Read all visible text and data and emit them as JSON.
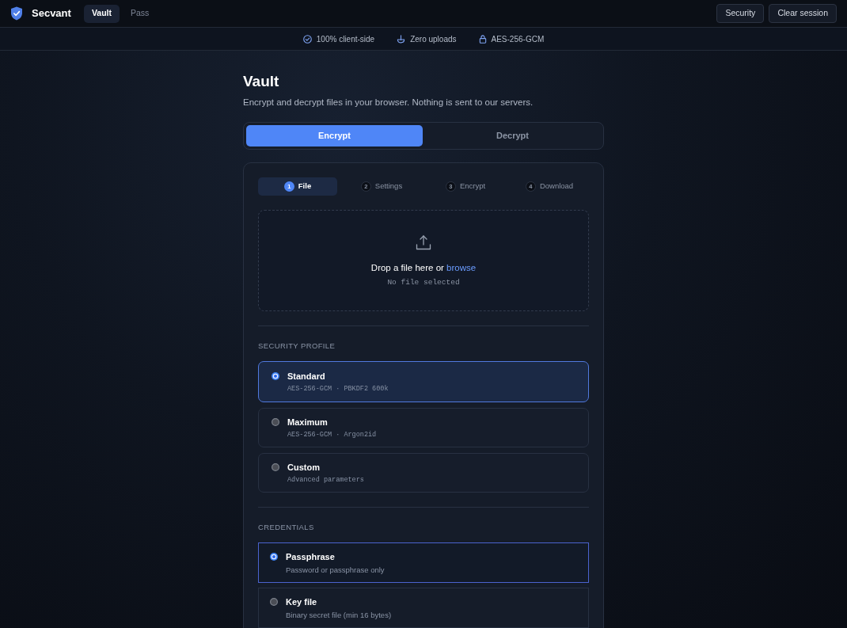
{
  "header": {
    "brand": "Secvant",
    "nav": [
      {
        "label": "Vault",
        "selected": true
      },
      {
        "label": "Pass",
        "selected": false
      }
    ],
    "buttons": [
      "Security",
      "Clear session"
    ]
  },
  "info_bar": [
    "100% client-side",
    "Zero uploads",
    "AES-256-GCM"
  ],
  "page": {
    "title": "Vault",
    "subtitle": "Encrypt and decrypt files in your browser. Nothing is sent to our servers."
  },
  "mode_tabs": [
    {
      "label": "Encrypt",
      "selected": true
    },
    {
      "label": "Decrypt",
      "selected": false
    }
  ],
  "steps": [
    {
      "number": "1",
      "label": "File",
      "selected": true
    },
    {
      "number": "2",
      "label": "Settings",
      "selected": false
    },
    {
      "number": "3",
      "label": "Encrypt",
      "selected": false
    },
    {
      "number": "4",
      "label": "Download",
      "selected": false
    }
  ],
  "dropzone": {
    "prompt": "Drop a file here or",
    "link": "browse",
    "status": "No file selected"
  },
  "security_profile": {
    "heading": "SECURITY PROFILE",
    "options": [
      {
        "name": "Standard",
        "detail": "AES-256-GCM · PBKDF2 600k",
        "selected": true
      },
      {
        "name": "Maximum",
        "detail": "AES-256-GCM · Argon2id",
        "selected": false
      },
      {
        "name": "Custom",
        "detail": "Advanced parameters",
        "selected": false
      }
    ]
  },
  "credentials": {
    "heading": "CREDENTIALS",
    "options": [
      {
        "name": "Passphrase",
        "detail": "Password or passphrase only",
        "selected": true
      },
      {
        "name": "Key file",
        "detail": "Binary secret file (min 16 bytes)",
        "selected": false
      }
    ]
  }
}
